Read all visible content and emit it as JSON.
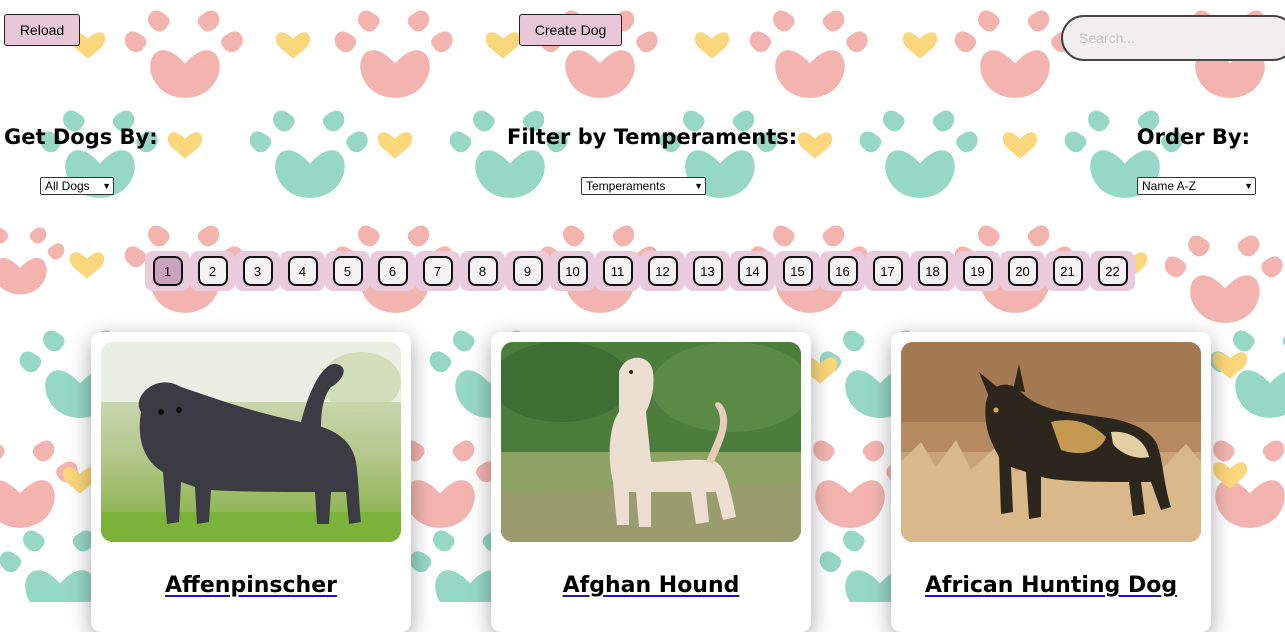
{
  "toolbar": {
    "reload_label": "Reload",
    "create_label": "Create Dog",
    "search_placeholder": "Search..."
  },
  "filters": {
    "get_heading": "Get Dogs By:",
    "get_value": "All Dogs",
    "temperament_heading": "Filter by Temperaments:",
    "temperament_value": "Temperaments",
    "order_heading": "Order By:",
    "order_value": "Name A-Z"
  },
  "pagination": {
    "pages": [
      "1",
      "2",
      "3",
      "4",
      "5",
      "6",
      "7",
      "8",
      "9",
      "10",
      "11",
      "12",
      "13",
      "14",
      "15",
      "16",
      "17",
      "18",
      "19",
      "20",
      "21",
      "22"
    ],
    "active": "1"
  },
  "cards": [
    {
      "name": "Affenpinscher"
    },
    {
      "name": "Afghan Hound"
    },
    {
      "name": "African Hunting Dog"
    }
  ],
  "colors": {
    "button_bg": "#e8c8d8",
    "paw_pink": "#eea7a7",
    "paw_teal": "#8fd4c0",
    "heart_yellow": "#fcd67a"
  }
}
